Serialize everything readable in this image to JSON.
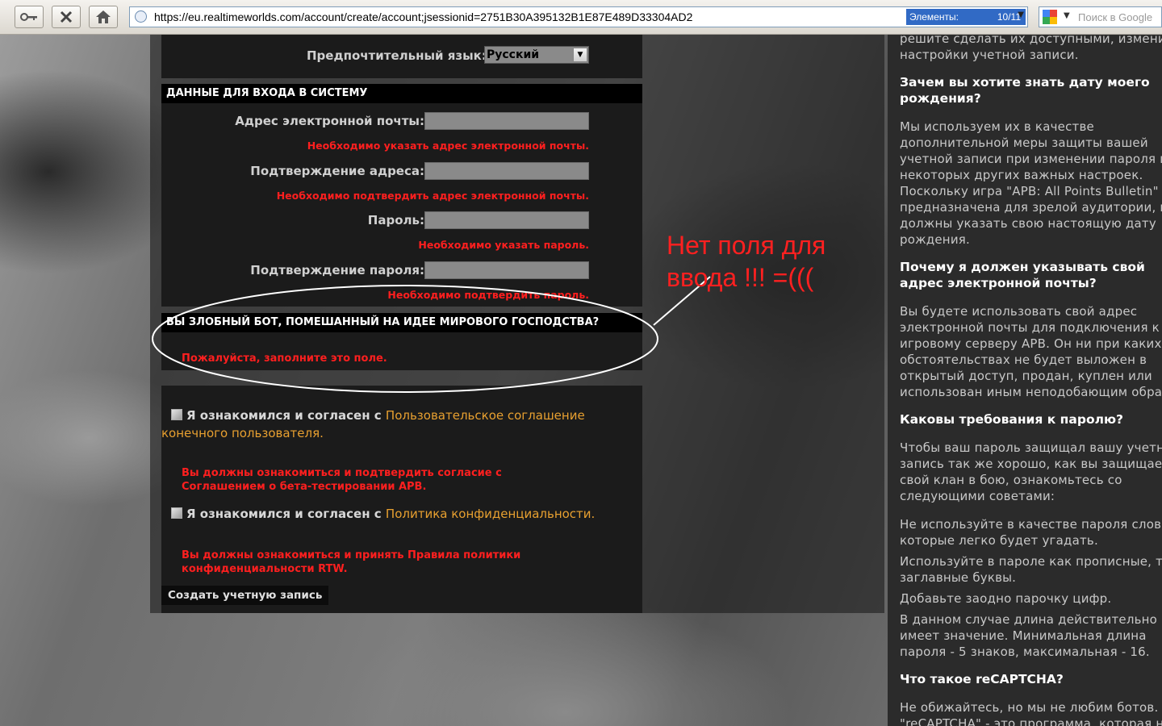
{
  "browser": {
    "url": "https://eu.realtimeworlds.com/account/create/account;jsessionid=2751B30A395132B1E87E489D33304AD2",
    "elements_label": "Элементы:",
    "elements_count": "10/11",
    "search_placeholder": "Поиск в Google"
  },
  "form": {
    "language_label": "Предпочтительный язык:",
    "language_value": "Русский",
    "login_section_title": "ДАННЫЕ ДЛЯ ВХОДА В СИСТЕМУ",
    "fields": [
      {
        "label": "Адрес электронной почты:",
        "error": "Необходимо указать адрес электронной почты."
      },
      {
        "label": "Подтверждение адреса:",
        "error": "Необходимо подтвердить адрес электронной почты."
      },
      {
        "label": "Пароль:",
        "error": "Необходимо указать пароль."
      },
      {
        "label": "Подтверждение пароля:",
        "error": "Необходимо подтвердить пароль."
      }
    ],
    "bot_section_title": "ВЫ ЗЛОБНЫЙ БОТ, ПОМЕШАННЫЙ НА ИДЕЕ МИРОВОГО ГОСПОДСТВА?",
    "bot_error": "Пожалуйста, заполните это поле.",
    "agree1_prefix": "Я ознакомился и согласен с ",
    "agree1_link": "Пользовательское соглашение конечного пользователя",
    "agree1_suffix": ".",
    "agree1_error": "Вы должны ознакомиться и подтвердить согласие с Соглашением о бета-тестировании APB.",
    "agree2_prefix": "Я ознакомился и согласен с ",
    "agree2_link": "Политика конфиденциальности",
    "agree2_suffix": ".",
    "agree2_error": "Вы должны ознакомиться и принять Правила политики конфиденциальности RTW.",
    "submit_label": "Создать учетную запись"
  },
  "annotation": {
    "text_line1": "Нет поля для",
    "text_line2": "ввода !!! =((("
  },
  "sidebar": {
    "blocks": [
      {
        "type": "p",
        "text": "решите сделать их доступными, изменив настройки учетной записи."
      },
      {
        "type": "h",
        "text": "Зачем вы хотите знать дату моего рождения?"
      },
      {
        "type": "p",
        "text": "Мы используем их в качестве дополнительной меры защиты вашей учетной записи при изменении пароля или некоторых других важных настроек. Поскольку игра \"APB: All Points Bulletin\" предназначена для зрелой аудитории, вы должны указать свою настоящую дату рождения."
      },
      {
        "type": "h",
        "text": "Почему я должен указывать свой адрес электронной почты?"
      },
      {
        "type": "p",
        "text": "Вы будете использовать свой адрес электронной почты для подключения к игровому серверу APB. Он ни при каких обстоятельствах не будет выложен в открытый доступ, продан, куплен или использован иным неподобающим образом."
      },
      {
        "type": "h",
        "text": "Каковы требования к паролю?"
      },
      {
        "type": "p",
        "text": "Чтобы ваш пароль защищал вашу учетную запись так же хорошо, как вы защищаете свой клан в бою, ознакомьтесь со следующими советами:"
      },
      {
        "type": "p",
        "text": "Не используйте в качестве пароля слова, которые легко будет угадать."
      },
      {
        "type": "p",
        "text": "Используйте в пароле как прописные, так и заглавные буквы."
      },
      {
        "type": "p",
        "text": "Добавьте заодно парочку цифр."
      },
      {
        "type": "p",
        "text": "В данном случае длина действительно имеет значение. Минимальная длина пароля - 5 знаков, максимальная - 16."
      },
      {
        "type": "h",
        "text": "Что такое reCAPTCHA?"
      },
      {
        "type": "p",
        "text": "Не обижайтесь, но мы не любим ботов. \"reCAPTCHA\" - это программа, которая не позволяет ботам регистрироваться."
      }
    ]
  }
}
